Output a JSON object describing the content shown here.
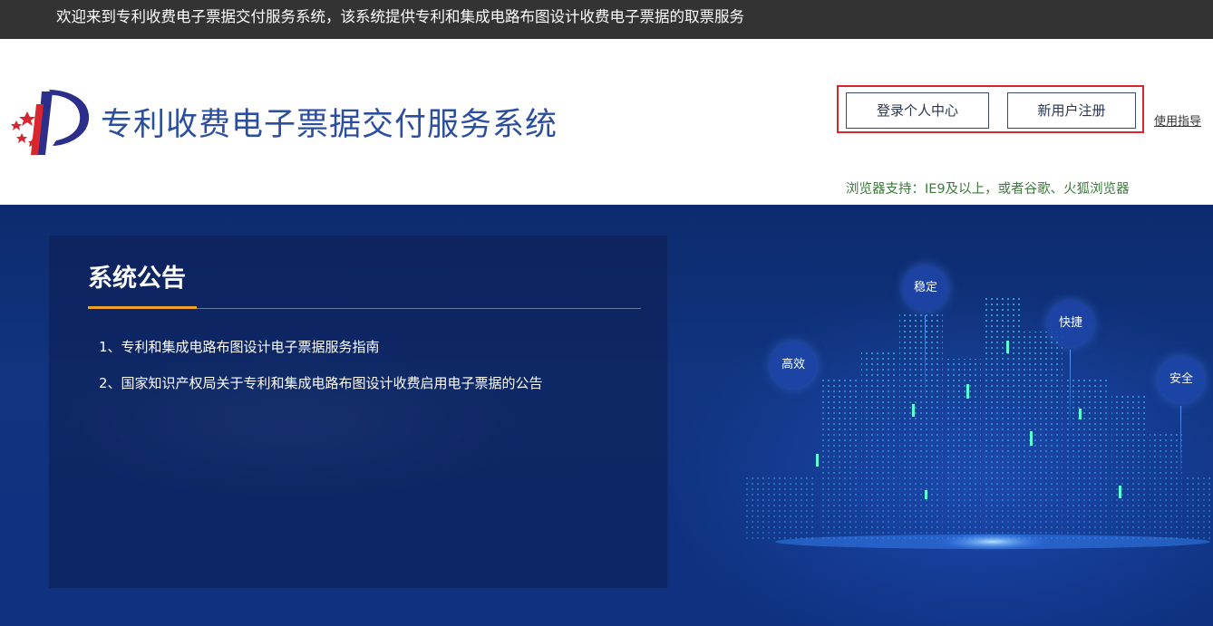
{
  "topbar": {
    "welcome": "欢迎来到专利收费电子票据交付服务系统，该系统提供专利和集成电路布图设计收费电子票据的取票服务"
  },
  "header": {
    "site_title": "专利收费电子票据交付服务系统",
    "login_label": "登录个人中心",
    "register_label": "新用户注册",
    "guide_label": "使用指导",
    "browser_note": "浏览器支持：IE9及以上，或者谷歌、火狐浏览器"
  },
  "notice": {
    "title": "系统公告",
    "items": [
      "1、专利和集成电路布图设计电子票据服务指南",
      "2、国家知识产权局关于专利和集成电路布图设计收费启用电子票据的公告"
    ]
  },
  "banner": {
    "features": [
      "稳定",
      "快捷",
      "高效",
      "安全"
    ]
  },
  "colors": {
    "title_blue": "#2b4f9e",
    "auth_highlight": "#d9262e",
    "accent_orange": "#f0a020",
    "note_green": "#3b7a3b"
  }
}
